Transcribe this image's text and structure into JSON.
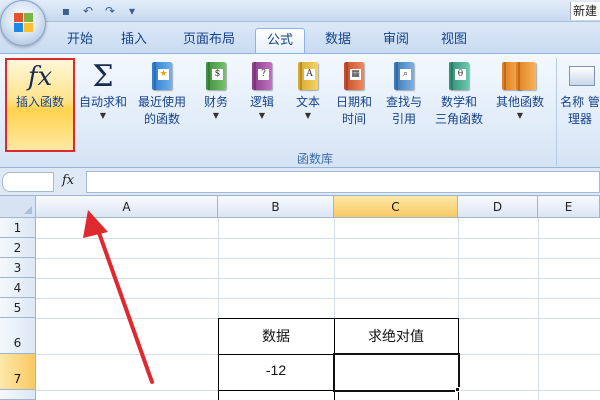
{
  "window": {
    "title_fragment": "新建"
  },
  "quick_access": {
    "save_icon": "save-icon",
    "undo_icon": "undo-icon",
    "redo_icon": "redo-icon"
  },
  "tabs": [
    {
      "label": "开始"
    },
    {
      "label": "插入"
    },
    {
      "label": "页面布局"
    },
    {
      "label": "公式"
    },
    {
      "label": "数据"
    },
    {
      "label": "审阅"
    },
    {
      "label": "视图"
    }
  ],
  "active_tab": "公式",
  "ribbon": {
    "insert_function": {
      "label": "插入函数",
      "glyph": "fx"
    },
    "autosum": {
      "label": "自动求和",
      "glyph": "Σ"
    },
    "recent": {
      "line1": "最近使用",
      "line2": "的函数"
    },
    "financial": {
      "label": "财务"
    },
    "logical": {
      "label": "逻辑"
    },
    "text": {
      "label": "文本"
    },
    "datetime": {
      "line1": "日期和",
      "line2": "时间"
    },
    "lookup": {
      "line1": "查找与",
      "line2": "引用"
    },
    "math": {
      "line1": "数学和",
      "line2": "三角函数"
    },
    "more": {
      "label": "其他函数"
    },
    "group_label": "函数库",
    "name_manager": {
      "line1": "名称",
      "line2": "管理器"
    }
  },
  "formula_bar": {
    "fx_label": "fx",
    "name_box_value": "",
    "formula_value": ""
  },
  "sheet": {
    "columns": [
      "A",
      "B",
      "C",
      "D",
      "E"
    ],
    "selected_column": "C",
    "rows": [
      "1",
      "2",
      "3",
      "4",
      "5",
      "6",
      "7"
    ],
    "selected_row": "7",
    "cells": {
      "B6": "数据",
      "C6": "求绝对值",
      "B7": "-12",
      "C7": ""
    }
  },
  "colors": {
    "highlight_red": "#e0282f",
    "selected_header": "#f9c962",
    "ribbon_text": "#15428b"
  }
}
